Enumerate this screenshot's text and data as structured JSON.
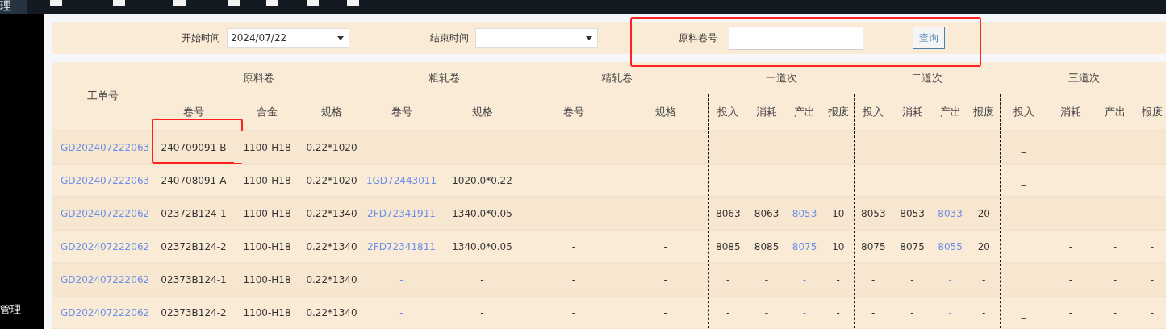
{
  "top_nav": {
    "active_item": "理"
  },
  "sidebar": {
    "items": [
      {
        "label": "管理"
      }
    ]
  },
  "filters": {
    "highlighted": true,
    "fields": [
      {
        "kind": "select",
        "label": "开始时间",
        "value": "2024/07/22"
      },
      {
        "kind": "select",
        "label": "结束时间"
      },
      {
        "kind": "input",
        "label": "原料卷号"
      }
    ],
    "button": "查询"
  },
  "table": {
    "groups": [
      {
        "label": "原料卷",
        "kind": "raw"
      },
      {
        "label": "粗轧卷",
        "kind": "coil"
      },
      {
        "label": "精轧卷",
        "kind": "coil"
      },
      {
        "label": "一道次",
        "kind": "pass"
      },
      {
        "label": "二道次",
        "kind": "pass"
      },
      {
        "label": "三道次",
        "kind": "pass"
      }
    ],
    "first_column": "工单号",
    "columns": [
      {
        "label": "卷号",
        "kind": "text"
      },
      {
        "label": "合金",
        "kind": "text"
      },
      {
        "label": "规格",
        "kind": "text"
      },
      {
        "label": "卷号",
        "kind": "link"
      },
      {
        "label": "规格",
        "kind": "text"
      },
      {
        "label": "卷号",
        "kind": "text"
      },
      {
        "label": "规格",
        "kind": "text"
      },
      {
        "label": "投入",
        "kind": "text"
      },
      {
        "label": "消耗",
        "kind": "text"
      },
      {
        "label": "产出",
        "kind": "link"
      },
      {
        "label": "报废",
        "kind": "text"
      },
      {
        "label": "投入",
        "kind": "text"
      },
      {
        "label": "消耗",
        "kind": "text"
      },
      {
        "label": "产出",
        "kind": "link"
      },
      {
        "label": "报废",
        "kind": "text"
      },
      {
        "label": "投入",
        "kind": "text"
      },
      {
        "label": "消耗",
        "kind": "text"
      },
      {
        "label": "产出",
        "kind": "text"
      },
      {
        "label": "报废",
        "kind": "text"
      }
    ],
    "rows": [
      {
        "order": "GD202407222063",
        "coil_highlighted": true,
        "cells": [
          "240709091-B",
          "1100-H18",
          "0.22*1020",
          "-",
          "-",
          "-",
          "-",
          "-",
          "-",
          "-",
          "-",
          "-",
          "-",
          "-",
          "-",
          "_",
          "-",
          "-",
          "-"
        ]
      },
      {
        "order": "GD202407222063",
        "cells": [
          "240708091-A",
          "1100-H18",
          "0.22*1020",
          "1GD72443011",
          "1020.0*0.22",
          "-",
          "-",
          "-",
          "-",
          "-",
          "-",
          "-",
          "-",
          "-",
          "-",
          "_",
          "-",
          "-",
          "-"
        ]
      },
      {
        "order": "GD202407222062",
        "cells": [
          "02372B124-1",
          "1100-H18",
          "0.22*1340",
          "2FD72341911",
          "1340.0*0.05",
          "-",
          "-",
          "8063",
          "8063",
          "8053",
          "10",
          "8053",
          "8053",
          "8033",
          "20",
          "_",
          "-",
          "-",
          "-"
        ]
      },
      {
        "order": "GD202407222062",
        "cells": [
          "02372B124-2",
          "1100-H18",
          "0.22*1340",
          "2FD72341811",
          "1340.0*0.05",
          "-",
          "-",
          "8085",
          "8085",
          "8075",
          "10",
          "8075",
          "8075",
          "8055",
          "20",
          "_",
          "-",
          "-",
          "-"
        ]
      },
      {
        "order": "GD202407222062",
        "cells": [
          "02373B124-1",
          "1100-H18",
          "0.22*1340",
          "-",
          "-",
          "-",
          "-",
          "-",
          "-",
          "-",
          "-",
          "-",
          "-",
          "-",
          "-",
          "_",
          "-",
          "-",
          "-"
        ]
      },
      {
        "order": "GD202407222062",
        "cells": [
          "02373B124-2",
          "1100-H18",
          "0.22*1340",
          "-",
          "-",
          "-",
          "-",
          "-",
          "-",
          "-",
          "-",
          "-",
          "-",
          "-",
          "-",
          "_",
          "-",
          "-",
          "-"
        ]
      }
    ]
  }
}
